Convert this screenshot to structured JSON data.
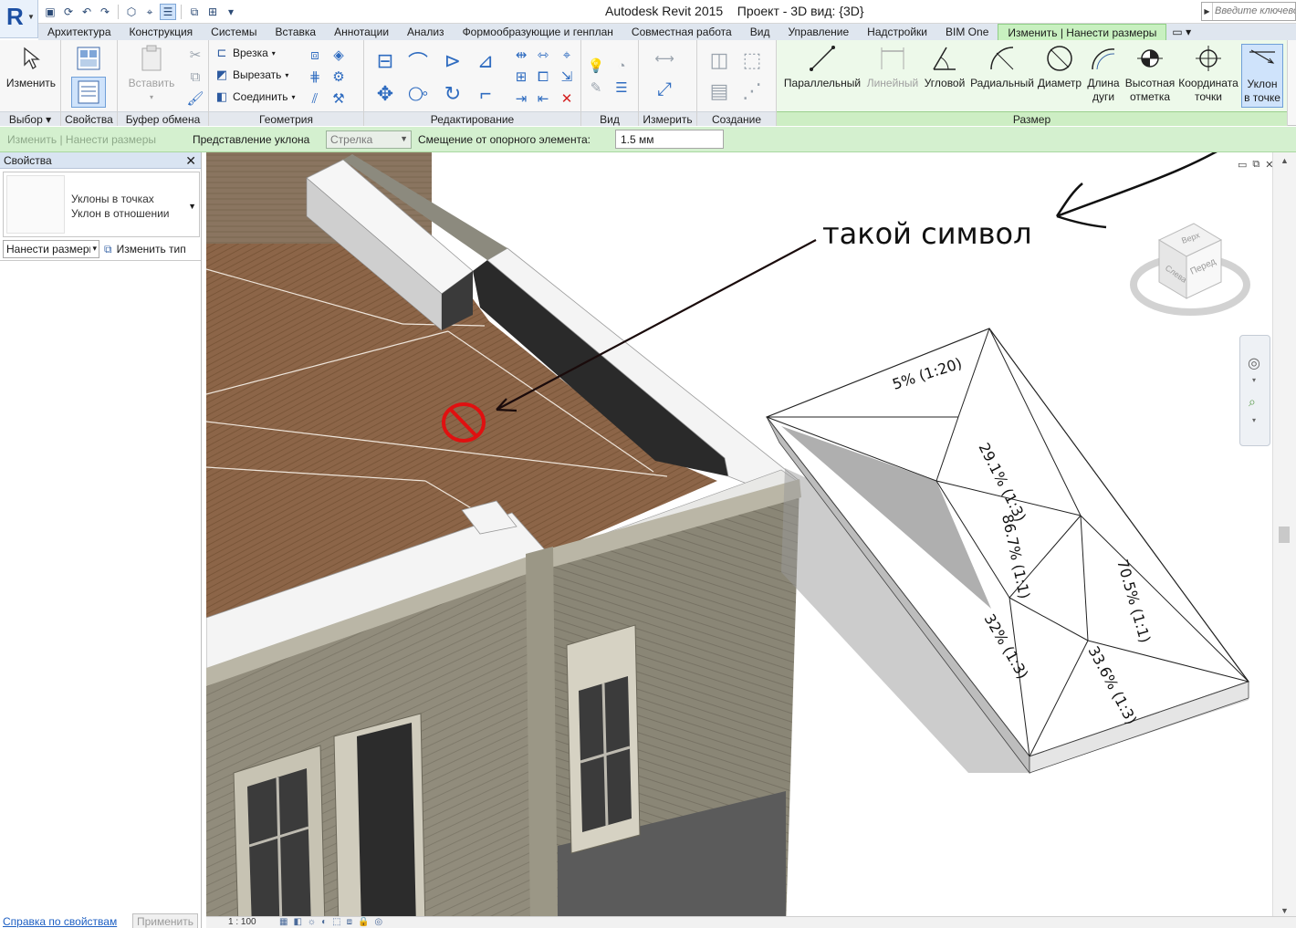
{
  "window": {
    "title": "Autodesk Revit 2015    Проект - 3D вид: {3D}",
    "app_letter": "R",
    "search_placeholder": "Введите ключевое"
  },
  "tabs": [
    "Архитектура",
    "Конструкция",
    "Системы",
    "Вставка",
    "Аннотации",
    "Анализ",
    "Формообразующие и генплан",
    "Совместная работа",
    "Вид",
    "Управление",
    "Надстройки",
    "BIM One",
    "Изменить | Нанести размеры"
  ],
  "active_tab": "Изменить | Нанести размеры",
  "ribbon": {
    "select_panel": {
      "title": "Выбор",
      "modify_label": "Изменить"
    },
    "properties_panel": {
      "title": "Свойства"
    },
    "clipboard_panel": {
      "title": "Буфер обмена",
      "paste_label": "Вставить"
    },
    "geometry_panel": {
      "title": "Геометрия",
      "cope": "Врезка",
      "cut": "Вырезать",
      "join": "Соединить"
    },
    "modify_panel": {
      "title": "Редактирование"
    },
    "view_panel": {
      "title": "Вид"
    },
    "measure_panel": {
      "title": "Измерить"
    },
    "create_panel": {
      "title": "Создание"
    },
    "dimension_panel": {
      "title": "Размер",
      "tools": [
        {
          "l1": "Параллельный",
          "l2": ""
        },
        {
          "l1": "Линейный",
          "l2": ""
        },
        {
          "l1": "Угловой",
          "l2": ""
        },
        {
          "l1": "Радиальный",
          "l2": ""
        },
        {
          "l1": "Диаметр",
          "l2": ""
        },
        {
          "l1": "Длина",
          "l2": "дуги"
        },
        {
          "l1": "Высотная",
          "l2": "отметка"
        },
        {
          "l1": "Координата",
          "l2": "точки"
        },
        {
          "l1": "Уклон",
          "l2": "в точке"
        }
      ]
    }
  },
  "options_bar": {
    "context": "Изменить | Нанести размеры",
    "slope_rep_label": "Представление уклона",
    "slope_rep_value": "Стрелка",
    "offset_label": "Смещение от опорного элемента:",
    "offset_value": "1.5 мм"
  },
  "properties": {
    "header": "Свойства",
    "type_line1": "Уклоны в точках",
    "type_line2": "Уклон в отношении",
    "filter_value": "Нанести размеры",
    "edit_type": "Изменить тип",
    "help_link": "Справка по свойствам",
    "apply_button": "Применить"
  },
  "viewcube": {
    "top": "Верх",
    "front": "Перед",
    "side": "Слева"
  },
  "annotation_text": "такой символ",
  "slope_labels": [
    "5% (1:20)",
    "29.1% (1:3)",
    "86.7% (1:1)",
    "70.5% (1:1)",
    "32% (1:3)",
    "33.6% (1:3)"
  ],
  "status": {
    "scale": "1 : 100"
  },
  "colors": {
    "active_tab": "#c8f0c0",
    "floor": "#8a6446",
    "wall": "#8f8b7c",
    "marker": "#e01010"
  }
}
